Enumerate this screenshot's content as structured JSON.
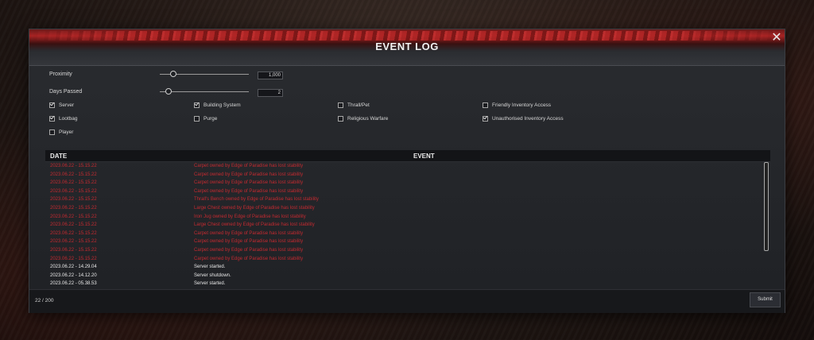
{
  "window": {
    "title": "EVENT LOG"
  },
  "filters": {
    "proximity": {
      "label": "Proximity",
      "value": "1,000",
      "slider_fraction": 0.15
    },
    "days_passed": {
      "label": "Days Passed",
      "value": "2",
      "slider_fraction": 0.1
    },
    "checkboxes": [
      {
        "label": "Server",
        "checked": true
      },
      {
        "label": "Building System",
        "checked": true
      },
      {
        "label": "Thrall/Pet",
        "checked": false
      },
      {
        "label": "Friendly Inventory Access",
        "checked": false
      },
      {
        "label": "Lootbag",
        "checked": true
      },
      {
        "label": "Purge",
        "checked": false
      },
      {
        "label": "Religious Warfare",
        "checked": false
      },
      {
        "label": "Unauthorised Inventory Access",
        "checked": true
      },
      {
        "label": "Player",
        "checked": false
      }
    ]
  },
  "table": {
    "headers": {
      "date": "DATE",
      "event": "EVENT"
    },
    "rows": [
      {
        "date": "2023.06.22 - 15.15.22",
        "event": "Carpet owned by Edge of Paradise has lost stability",
        "color": "#c42a30"
      },
      {
        "date": "2023.06.22 - 15.15.22",
        "event": "Carpet owned by Edge of Paradise has lost stability",
        "color": "#c42a30"
      },
      {
        "date": "2023.06.22 - 15.15.22",
        "event": "Carpet owned by Edge of Paradise has lost stability",
        "color": "#c42a30"
      },
      {
        "date": "2023.06.22 - 15.15.22",
        "event": "Carpet owned by Edge of Paradise has lost stability",
        "color": "#c42a30"
      },
      {
        "date": "2023.06.22 - 15.15.22",
        "event": "Thrall's Bench owned by Edge of Paradise has lost stability",
        "color": "#c42a30"
      },
      {
        "date": "2023.06.22 - 15.15.22",
        "event": "Large Chest owned by Edge of Paradise has lost stability",
        "color": "#c42a30"
      },
      {
        "date": "2023.06.22 - 15.15.22",
        "event": "Iron Jug owned by Edge of Paradise has lost stability",
        "color": "#c42a30"
      },
      {
        "date": "2023.06.22 - 15.15.22",
        "event": "Large Chest owned by Edge of Paradise has lost stability",
        "color": "#c42a30"
      },
      {
        "date": "2023.06.22 - 15.15.22",
        "event": "Carpet owned by Edge of Paradise has lost stability",
        "color": "#c42a30"
      },
      {
        "date": "2023.06.22 - 15.15.22",
        "event": "Carpet owned by Edge of Paradise has lost stability",
        "color": "#c42a30"
      },
      {
        "date": "2023.06.22 - 15.15.22",
        "event": "Carpet owned by Edge of Paradise has lost stability",
        "color": "#c42a30"
      },
      {
        "date": "2023.06.22 - 15.15.22",
        "event": "Carpet owned by Edge of Paradise has lost stability",
        "color": "#c42a30"
      },
      {
        "date": "2023.06.22 - 14.29.04",
        "event": "Server started.",
        "color": "#e8e8e8"
      },
      {
        "date": "2023.06.22 - 14.12.20",
        "event": "Server shutdown.",
        "color": "#e8e8e8"
      },
      {
        "date": "2023.06.22 - 05.38.53",
        "event": "Server started.",
        "color": "#e8e8e8"
      }
    ]
  },
  "footer": {
    "count": "22 / 200",
    "submit_label": "Submit"
  }
}
